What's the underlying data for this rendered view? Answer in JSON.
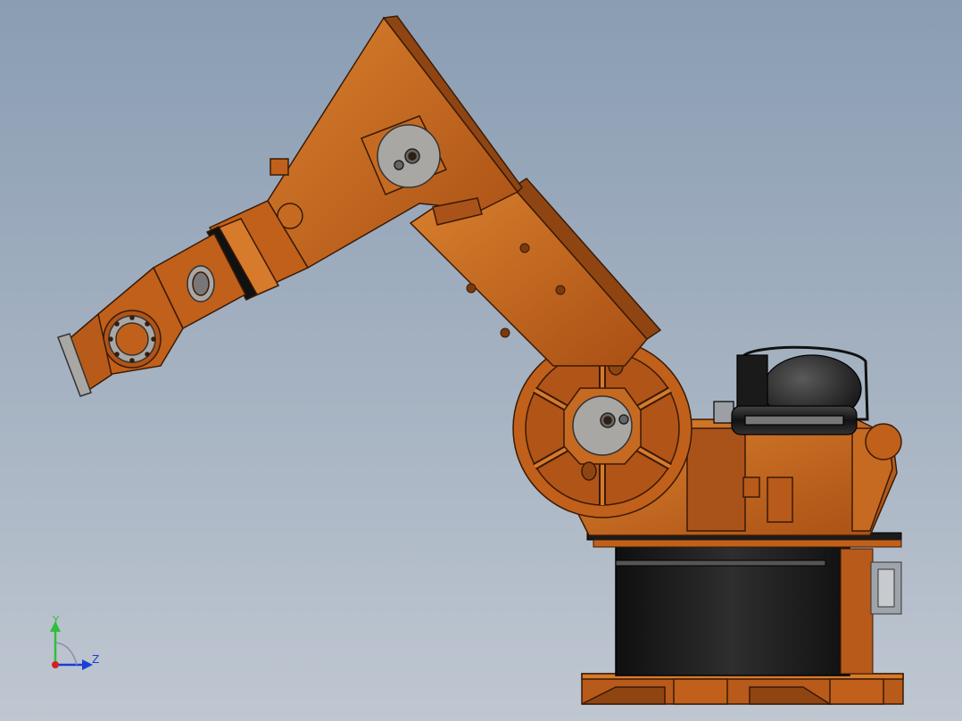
{
  "window": {
    "title": ""
  },
  "colors": {
    "background_top": "#8a9db3",
    "background_bottom": "#bfc7d1",
    "robot_body": "#c0601a",
    "robot_shadow": "#8f4512",
    "robot_highlight": "#d9802e",
    "flange_gray": "#a9a7a3",
    "base_black": "#1e1e1e",
    "axis_y": "#2fbf3a",
    "axis_z": "#1a3fd6",
    "axis_x": "#d42020"
  },
  "triad": {
    "y_label": "Y",
    "z_label": "Z",
    "y_color": "#2fbf3a",
    "z_color": "#1a3fd6"
  },
  "model": {
    "name": "industrial-robot-arm",
    "parts": [
      "base-pedestal",
      "rotating-column",
      "counterbalance-cylinder",
      "lower-arm",
      "upper-arm",
      "forearm",
      "wrist",
      "tool-flange"
    ]
  }
}
